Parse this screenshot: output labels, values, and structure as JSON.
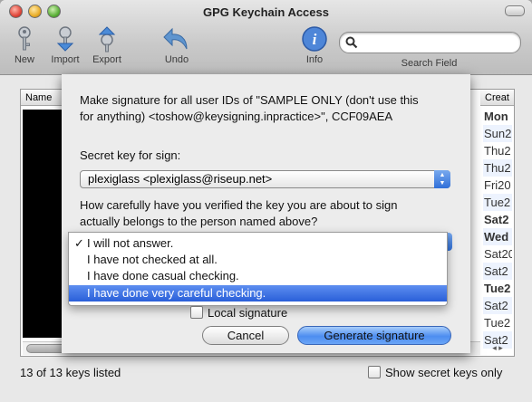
{
  "window": {
    "title": "GPG Keychain Access"
  },
  "toolbar": {
    "new": "New",
    "import": "Import",
    "export": "Export",
    "undo": "Undo",
    "info": "Info",
    "search_label": "Search Field",
    "search_value": ""
  },
  "table": {
    "col_name": "Name",
    "col_created": "Creat",
    "created_values": [
      "Mon",
      "Sun2",
      "Thu2",
      "Thu2",
      "Fri20",
      "Tue2",
      "Sat2",
      "Wed",
      "Sat20",
      "Sat2",
      "Tue2",
      "Sat2",
      "Tue2",
      "Sat2"
    ],
    "bold_rows": [
      0,
      6,
      7,
      10
    ]
  },
  "footer": {
    "count_text": "13 of 13 keys listed",
    "show_secret_label": "Show secret keys only",
    "show_secret_checked": false
  },
  "sheet": {
    "message_line1": "Make signature for all user IDs of \"SAMPLE ONLY (don't use this",
    "message_line2": "for anything) <toshow@keysigning.inpractice>\", CCF09AEA",
    "secret_key_label": "Secret key for sign:",
    "secret_key_value": "plexiglass <plexiglass@riseup.net>",
    "question_line1": "How carefully have you verified the key you are about to sign",
    "question_line2": "actually belongs to the person named above?",
    "options": [
      {
        "label": "I will not answer.",
        "checked": true,
        "highlighted": false
      },
      {
        "label": "I have not checked at all.",
        "checked": false,
        "highlighted": false
      },
      {
        "label": "I have done casual checking.",
        "checked": false,
        "highlighted": false
      },
      {
        "label": "I have done very careful checking.",
        "checked": false,
        "highlighted": true
      }
    ],
    "check_mark": "✓",
    "local_signature_label": "Local signature",
    "local_signature_checked": false,
    "cancel_label": "Cancel",
    "generate_label": "Generate signature"
  },
  "colors": {
    "accent": "#2a5fd9",
    "selection": "#5d8ef0",
    "window_bg": "#e8e8e8"
  }
}
